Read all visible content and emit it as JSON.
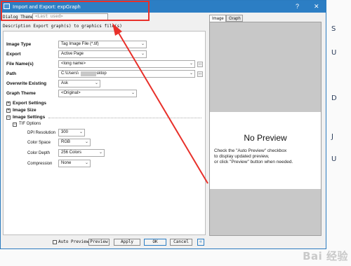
{
  "window": {
    "title": "Import and Export: expGraph",
    "help_label": "?",
    "close_label": "✕"
  },
  "dialog_theme": {
    "label": "Dialog Theme",
    "value": "<Last used>"
  },
  "description": {
    "label": "Description",
    "text": "Export graph(s) to graphics file(s)"
  },
  "settings": {
    "image_type": {
      "label": "Image Type",
      "value": "Tag Image File (*.tif)"
    },
    "export": {
      "label": "Export",
      "value": "Active Page"
    },
    "file_name": {
      "label": "File Name(s)",
      "value": "<long name>",
      "browse": "..."
    },
    "path": {
      "label": "Path",
      "value_prefix": "C:\\Users\\",
      "value_suffix": "esktop",
      "browse": "..."
    },
    "overwrite": {
      "label": "Overwrite Existing",
      "value": "Ask"
    },
    "graph_theme": {
      "label": "Graph Theme",
      "value": "<Original>"
    }
  },
  "sections": {
    "export_settings": {
      "label": "Export Settings",
      "toggle": "+"
    },
    "image_size": {
      "label": "Image Size",
      "toggle": "+"
    },
    "image_settings": {
      "label": "Image Settings",
      "toggle": "−"
    },
    "tif_options": {
      "label": "TIF Options",
      "toggle": "−"
    }
  },
  "tif": {
    "dpi": {
      "label": "DPI Resolution",
      "value": "300"
    },
    "color_space": {
      "label": "Color Space",
      "value": "RGB"
    },
    "color_depth": {
      "label": "Color Depth",
      "value": "256 Colors"
    },
    "compression": {
      "label": "Compression",
      "value": "None"
    }
  },
  "preview": {
    "tabs": [
      "Image",
      "Graph"
    ],
    "title": "No Preview",
    "hint_line1": "Check the \"Auto Preview\" checkbox",
    "hint_line2": "to display updated preview,",
    "hint_line3": "or click \"Preview\" button when needed."
  },
  "buttons": {
    "auto_preview": "Auto Preview",
    "preview": "Preview",
    "apply": "Apply",
    "ok": "OK",
    "cancel": "Cancel",
    "collapse": "«"
  },
  "colors": {
    "titlebar": "#2c7ec4",
    "highlight": "#e8302a"
  },
  "watermark": "Bai 经验"
}
